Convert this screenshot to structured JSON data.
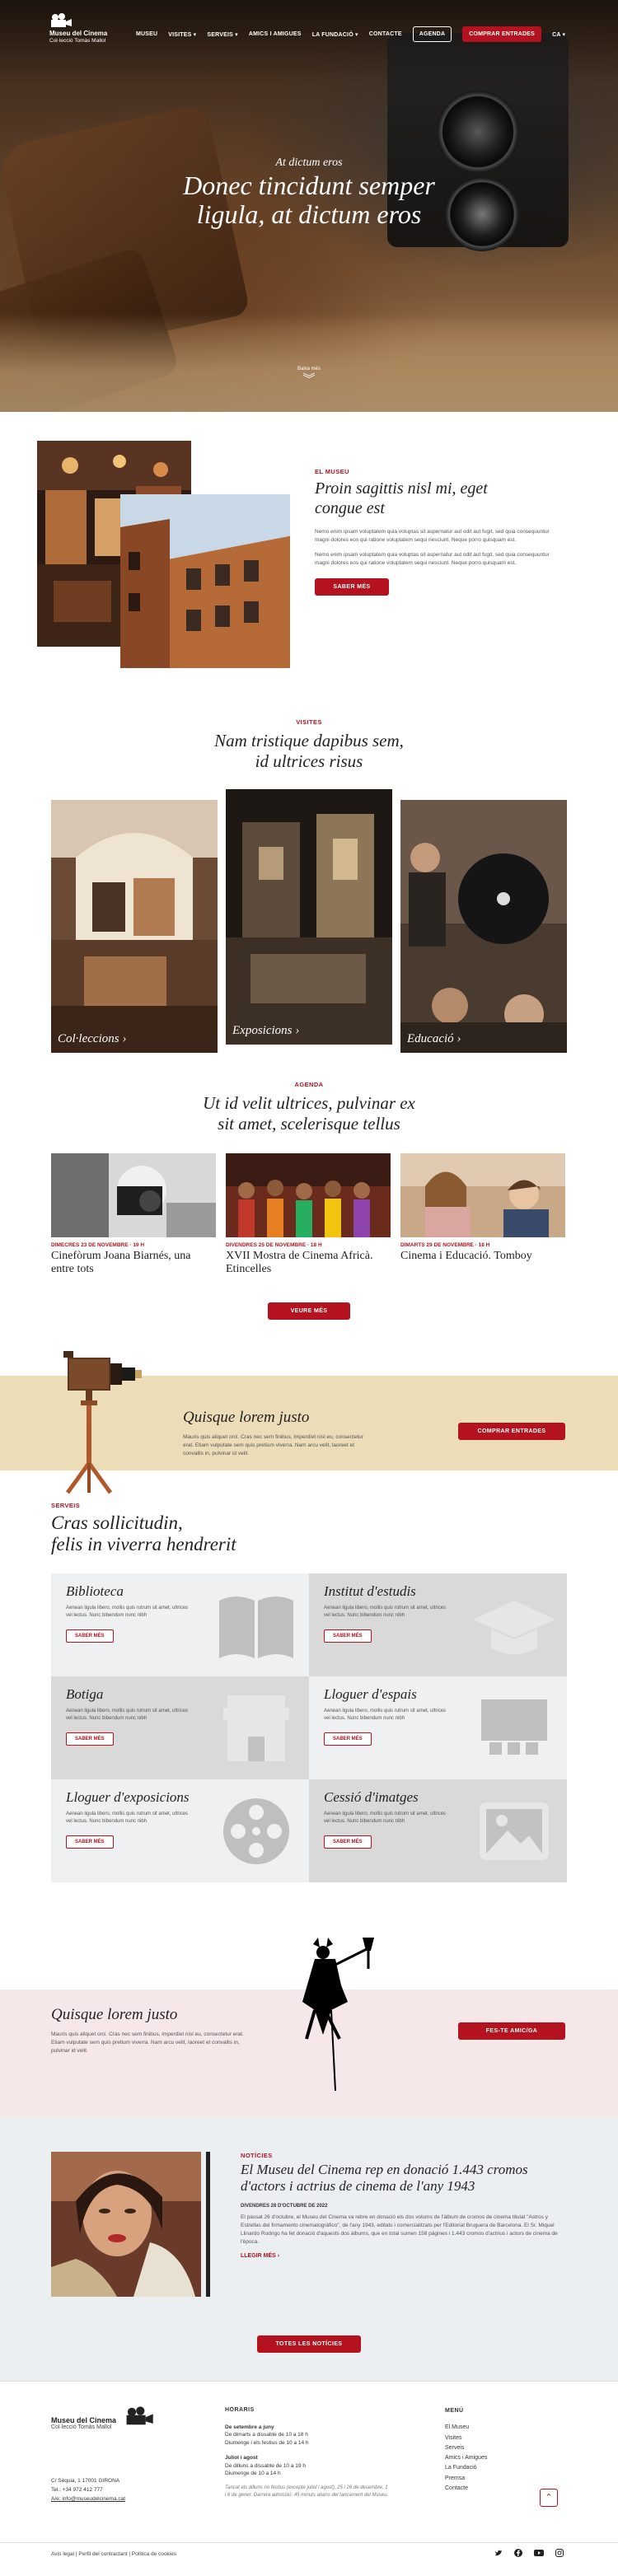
{
  "brand": {
    "name": "Museu del Cinema",
    "subtitle": "Col·lecció Tomàs Mallol"
  },
  "nav": {
    "items": [
      "MUSEU",
      "VISITES ▾",
      "SERVEIS ▾",
      "AMICS I AMIGUES",
      "LA FUNDACIÓ ▾",
      "CONTACTE"
    ],
    "agenda": "AGENDA",
    "buy": "COMPRAR ENTRADES",
    "lang": "CA ▾"
  },
  "hero": {
    "kicker": "At dictum eros",
    "title_line1": "Donec tincidunt semper",
    "title_line2": "ligula, at dictum eros",
    "scroll_label": "Baixa més"
  },
  "about": {
    "label": "EL MUSEU",
    "title_line1": "Proin sagittis nisl mi, eget",
    "title_line2": "congue est",
    "para1": "Nemo enim ipsam voluptatem quia voluptas sit aspernatur aut odit aut fugit, sed quia consequuntur magni dolores eos qui ratione voluptatem sequi nesciunt. Neque porro quisquam est.",
    "para2": "Nemo enim ipsam voluptatem quia voluptas sit aspernatur aut odit aut fugit, sed quia consequuntur magni dolores eos qui ratione voluptatem sequi nesciunt. Neque porro quisquam est.",
    "button": "SABER MÉS"
  },
  "visits": {
    "label": "VISITES",
    "title_line1": "Nam tristique dapibus sem,",
    "title_line2": "id ultrices risus",
    "cards": [
      "Col·leccions ›",
      "Exposicions ›",
      "Educació ›"
    ]
  },
  "agenda": {
    "label": "AGENDA",
    "title_line1": "Ut id velit ultrices, pulvinar ex",
    "title_line2": "sit amet, scelerisque tellus",
    "events": [
      {
        "date": "DIMECRES 23 DE NOVEMBRE · 19 H",
        "title": "Cinefòrum Joana Biarnés, una entre tots"
      },
      {
        "date": "DIVENDRES 25 DE NOVEMBRE · 18 H",
        "title": "XVII Mostra de Cinema Africà. Etincelles"
      },
      {
        "date": "DIMARTS 29 DE NOVEMBRE · 18 H",
        "title": "Cinema i Educació. Tomboy"
      }
    ],
    "button": "VEURE MÉS"
  },
  "promo": {
    "title": "Quisque lorem justo",
    "text": "Mauris quis aliquet orci. Cras nec sem finibus, imperdiet nisl eu, consectetur erat. Etiam vulputate sem quis pretium viverra. Nam arcu velit, laoreet et convallis in, pulvinar id velit.",
    "button": "COMPRAR ENTRADES"
  },
  "services": {
    "label": "SERVEIS",
    "title_line1": "Cras sollicitudin,",
    "title_line2": "felis in viverra hendrerit",
    "items": [
      {
        "title": "Biblioteca",
        "text": "Aenean ligula libero, mollis quis rutrum sit amet, ultrices vel lectus. Nunc bibendum nunc nibh",
        "button": "SABER MÉS",
        "icon": "book-icon"
      },
      {
        "title": "Institut d'estudis",
        "text": "Aenean ligula libero, mollis quis rutrum sit amet, ultrices vel lectus. Nunc bibendum nunc nibh",
        "button": "SABER MÉS",
        "icon": "graduation-cap-icon"
      },
      {
        "title": "Botiga",
        "text": "Aenean ligula libero, mollis quis rutrum sit amet, ultrices vel lectus. Nunc bibendum nunc nibh",
        "button": "SABER MÉS",
        "icon": "shop-icon"
      },
      {
        "title": "Lloguer d'espais",
        "text": "Aenean ligula libero, mollis quis rutrum sit amet, ultrices vel lectus. Nunc bibendum nunc nibh",
        "button": "SABER MÉS",
        "icon": "projector-screen-icon"
      },
      {
        "title": "Lloguer d'exposicions",
        "text": "Aenean ligula libero, mollis quis rutrum sit amet, ultrices vel lectus. Nunc bibendum nunc nibh",
        "button": "SABER MÉS",
        "icon": "film-reel-icon"
      },
      {
        "title": "Cessió d'imatges",
        "text": "Aenean ligula libero, mollis quis rutrum sit amet, ultrices vel lectus. Nunc bibendum nunc nibh",
        "button": "SABER MÉS",
        "icon": "image-icon"
      }
    ]
  },
  "amics": {
    "title": "Quisque lorem justo",
    "text": "Mauris quis aliquet orci. Cras nec sem finibus, imperdiet nisl eu, consectetur erat. Etiam vulputate sem quis pretium viverra. Nam arcu velit, laoreet et convallis in, pulvinar id velit.",
    "button": "FES-TE AMIC/GA"
  },
  "news": {
    "label": "NOTÍCIES",
    "title_line1": "El Museu del Cinema rep en donació 1.443 cromos",
    "title_line2": "d'actors i actrius de cinema de l'any 1943",
    "date": "DIVENDRES 28 D'OCTUBRE DE 2022",
    "text": "El passat 26 d'octubre, el Museu del Cinema va rebre en donació els dos volums de l'àlbum de cromos de cinema titulat \"Astros y Estrellas del firmamento cinematográfico\", de l'any 1943, editats i comercialitzats per l'Editorial Bruguera de Barcelona. El Sr. Miquel Llinardo Rodrigo ha fet donació d'aquests dos àlbums, que en total sumen 158 pàgines i 1.443 cromos d'actrius i actors de cinema de l'època.",
    "link": "LLEGIR MÉS ›",
    "button": "TOTES LES NOTÍCIES"
  },
  "footer": {
    "address": [
      "C/ Sèquia, 1 17001 GIRONA",
      "Tel.: +34 972 412 777",
      "A/e: info@museudelcinema.cat"
    ],
    "hours_heading": "HORARIS",
    "hours": [
      {
        "title": "De setembre a juny",
        "lines": [
          "De dimarts a dissabte de 10 a 18 h",
          "Diumenge i els festius de 10 a 14 h"
        ]
      },
      {
        "title": "Juliol i agost",
        "lines": [
          "De dilluns a dissabte de 10 a 19 h",
          "Diumenge de 10 a 14 h"
        ]
      }
    ],
    "hours_note": "Tancat els dilluns no festius (excepte juliol i agost), 25 i 26 de desembre, 1 i 6 de gener. Darrera admissió: 45 minuts abans del tancament del Museu.",
    "menu_heading": "MENÚ",
    "menu": [
      "El Museu",
      "Visites",
      "Serveis",
      "Amics i Amigues",
      "La Fundació",
      "Premsa",
      "Contacte"
    ],
    "legal": "Avís legal  |  Perfil del contractant  |  Política de cookies",
    "social": [
      "twitter-icon",
      "facebook-icon",
      "youtube-icon",
      "instagram-icon"
    ]
  }
}
